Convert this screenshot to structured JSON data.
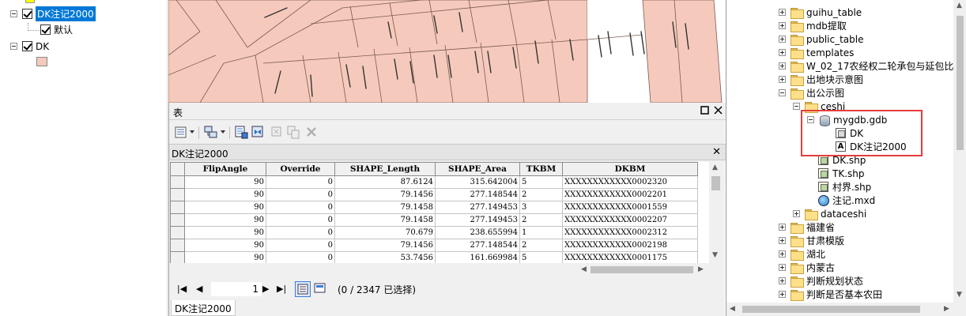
{
  "toc": {
    "layer_anno": "DK注记2000",
    "sublayer_default": "默认",
    "layer_dk": "DK"
  },
  "table_window": {
    "title": "表",
    "tab_title": "DK注记2000",
    "columns": [
      "FlipAngle",
      "Override",
      "SHAPE_Length",
      "SHAPE_Area",
      "TKBM",
      "DKBM"
    ],
    "rows": [
      [
        "90",
        "0",
        "87.6124",
        "315.642004",
        "5",
        "XXXXXXXXXXXX0002320"
      ],
      [
        "90",
        "0",
        "79.1456",
        "277.148544",
        "2",
        "XXXXXXXXXXXX0002201"
      ],
      [
        "90",
        "0",
        "79.1458",
        "277.149453",
        "3",
        "XXXXXXXXXXXX0001559"
      ],
      [
        "90",
        "0",
        "79.1458",
        "277.149453",
        "2",
        "XXXXXXXXXXXX0002207"
      ],
      [
        "90",
        "0",
        "70.679",
        "238.655994",
        "1",
        "XXXXXXXXXXXX0002312"
      ],
      [
        "90",
        "0",
        "79.1456",
        "277.148544",
        "2",
        "XXXXXXXXXXXX0002198"
      ],
      [
        "90",
        "0",
        "53.7456",
        "161.669984",
        "5",
        "XXXXXXXXXXXX0001175"
      ]
    ],
    "record_number": "1",
    "selection_status": "(0 / 2347 已选择)",
    "bottom_tab": "DK注记2000"
  },
  "catalog": {
    "items": [
      {
        "label": "guihu_table",
        "kind": "folder"
      },
      {
        "label": "mdb提取",
        "kind": "folder"
      },
      {
        "label": "public_table",
        "kind": "folder"
      },
      {
        "label": "templates",
        "kind": "folder"
      },
      {
        "label": "W_02_17农经权二轮承包与延包比",
        "kind": "folder"
      },
      {
        "label": "出地块示意图",
        "kind": "folder"
      },
      {
        "label": "出公示图",
        "kind": "folder"
      },
      {
        "label": "ceshi",
        "kind": "folder"
      },
      {
        "label": "mygdb.gdb",
        "kind": "gdb"
      },
      {
        "label": "DK",
        "kind": "feature-class"
      },
      {
        "label": "DK注记2000",
        "kind": "annotation-class"
      },
      {
        "label": "DK.shp",
        "kind": "shapefile"
      },
      {
        "label": "TK.shp",
        "kind": "shapefile"
      },
      {
        "label": "村界.shp",
        "kind": "shapefile"
      },
      {
        "label": "注记.mxd",
        "kind": "map-document"
      },
      {
        "label": "dataceshi",
        "kind": "folder"
      },
      {
        "label": "福建省",
        "kind": "folder"
      },
      {
        "label": "甘肃模版",
        "kind": "folder"
      },
      {
        "label": "湖北",
        "kind": "folder"
      },
      {
        "label": "内蒙古",
        "kind": "folder"
      },
      {
        "label": "判断规划状态",
        "kind": "folder"
      },
      {
        "label": "判断是否基本农田",
        "kind": "folder"
      }
    ]
  },
  "colors": {
    "parcel_fill": "#f5cabc",
    "selection_blue": "#0078d7",
    "highlight_box": "#e53d3d"
  }
}
